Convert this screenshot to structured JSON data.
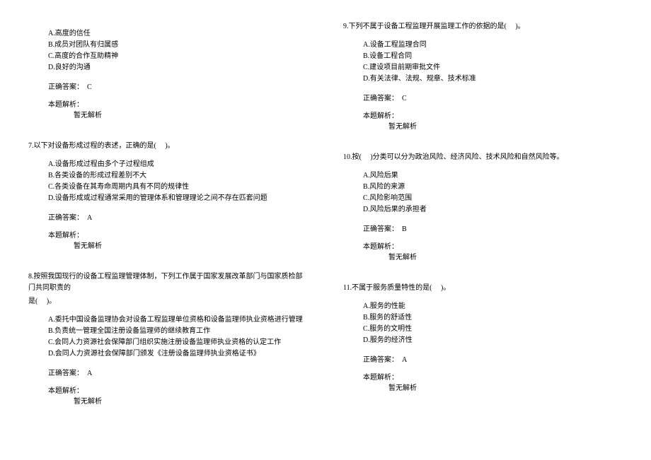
{
  "leftColumn": {
    "q6tail": {
      "options": {
        "a": "A.高度的信任",
        "b": "B.成员对团队有归属感",
        "c": "C.高度的合作互助精神",
        "d": "D.良好的沟通"
      },
      "answer": "正确答案：　C",
      "analysisLabel": "本题解析：",
      "analysisText": "暂无解析"
    },
    "q7": {
      "stem": "7.以下对设备形成过程的表述，正确的是(　 )。",
      "options": {
        "a": "A.设备形成过程由多个子过程组成",
        "b": "B.各类设备的形成过程差别不大",
        "c": "C.各类设备在其寿命周期内具有不同的规律性",
        "d": "D.设备形成或过程通常采用的管理体系和管理理论之间不存在匹套问题"
      },
      "answer": "正确答案：　A",
      "analysisLabel": "本题解析：",
      "analysisText": "暂无解析"
    },
    "q8": {
      "stem1": "8.按照我国现行的设备工程监理管理体制，下列工作属于国家发展改革部门与国家质检部门共同职责的",
      "stem2": "是(　 )。",
      "options": {
        "a": "A.委托中国设备监理协会对设备工程监理单位资格和设备监理师执业资格进行管理",
        "b": "B.负责统一管理全国注册设备监理师的继续教育工作",
        "c": "C.会同人力资源社会保障部门组织实施注册设备监理师执业资格的认定工作",
        "d": "D.会同人力资源社会保障部门颁发《注册设备监理师执业资格证书》"
      },
      "answer": "正确答案：　A",
      "analysisLabel": "本题解析：",
      "analysisText": "暂无解析"
    }
  },
  "rightColumn": {
    "q9": {
      "stem": "9.下列不属于设备工程监理开展监理工作的依据的是(　 )。",
      "options": {
        "a": "A.设备工程监理合同",
        "b": "B.设备工程合同",
        "c": "C.建设项目前期审批文件",
        "d": "D.有关法律、法规、规章、技术标准"
      },
      "answer": "正确答案：　C",
      "analysisLabel": "本题解析：",
      "analysisText": "暂无解析"
    },
    "q10": {
      "stem": "10.按(　 )分类可以分为政治风险、经济风险、技术风险和自然风险等。",
      "options": {
        "a": "A.风险后果",
        "b": "B.风险的来源",
        "c": "C.风险影响范围",
        "d": "D.风险后果的承担者"
      },
      "answer": "正确答案：　B",
      "analysisLabel": "本题解析：",
      "analysisText": "暂无解析"
    },
    "q11": {
      "stem": "11.不属于服务质量特性的是(　 )。",
      "options": {
        "a": "A.服务的性能",
        "b": "B.服务的舒适性",
        "c": "C.服务的文明性",
        "d": "D.服务的经济性"
      },
      "answer": "正确答案：　A",
      "analysisLabel": "本题解析：",
      "analysisText": "暂无解析"
    }
  }
}
